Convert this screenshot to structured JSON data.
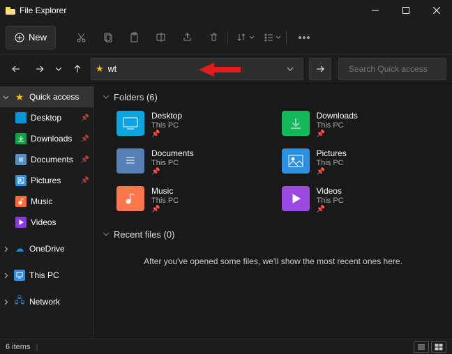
{
  "window": {
    "title": "File Explorer"
  },
  "toolbar": {
    "new_label": "New"
  },
  "address": {
    "value": "wt"
  },
  "search": {
    "placeholder": "Search Quick access"
  },
  "sidebar": {
    "quick_access": "Quick access",
    "desktop": "Desktop",
    "downloads": "Downloads",
    "documents": "Documents",
    "pictures": "Pictures",
    "music": "Music",
    "videos": "Videos",
    "onedrive": "OneDrive",
    "thispc": "This PC",
    "network": "Network"
  },
  "sections": {
    "folders_header": "Folders (6)",
    "recent_header": "Recent files (0)",
    "recent_empty": "After you've opened some files, we'll show the most recent ones here."
  },
  "folders": {
    "desktop": {
      "name": "Desktop",
      "sub": "This PC"
    },
    "downloads": {
      "name": "Downloads",
      "sub": "This PC"
    },
    "documents": {
      "name": "Documents",
      "sub": "This PC"
    },
    "pictures": {
      "name": "Pictures",
      "sub": "This PC"
    },
    "music": {
      "name": "Music",
      "sub": "This PC"
    },
    "videos": {
      "name": "Videos",
      "sub": "This PC"
    }
  },
  "status": {
    "count": "6 items"
  }
}
